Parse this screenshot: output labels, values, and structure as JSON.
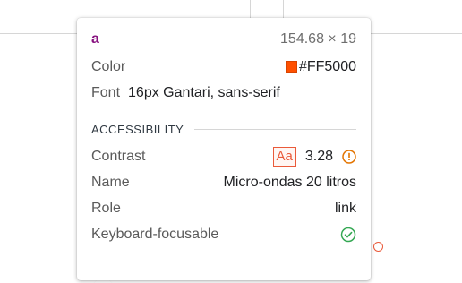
{
  "element": {
    "tag": "a",
    "dimensions": "154.68 × 19"
  },
  "properties": {
    "color_label": "Color",
    "color_value": "#FF5000",
    "font_label": "Font",
    "font_value": "16px Gantari, sans-serif"
  },
  "accessibility": {
    "title": "ACCESSIBILITY",
    "contrast_label": "Contrast",
    "contrast_badge": "Aa",
    "contrast_value": "3.28",
    "name_label": "Name",
    "name_value": "Micro-ondas 20 litros",
    "role_label": "Role",
    "role_value": "link",
    "keyboard_label": "Keyboard-focusable"
  },
  "colors": {
    "swatch": "#FF5000",
    "warning": "#e37400",
    "ok": "#34a853",
    "badge": "#ea5a3a"
  },
  "icons": {
    "contrast_status": "warning-circle-icon",
    "keyboard_status": "check-circle-icon"
  }
}
